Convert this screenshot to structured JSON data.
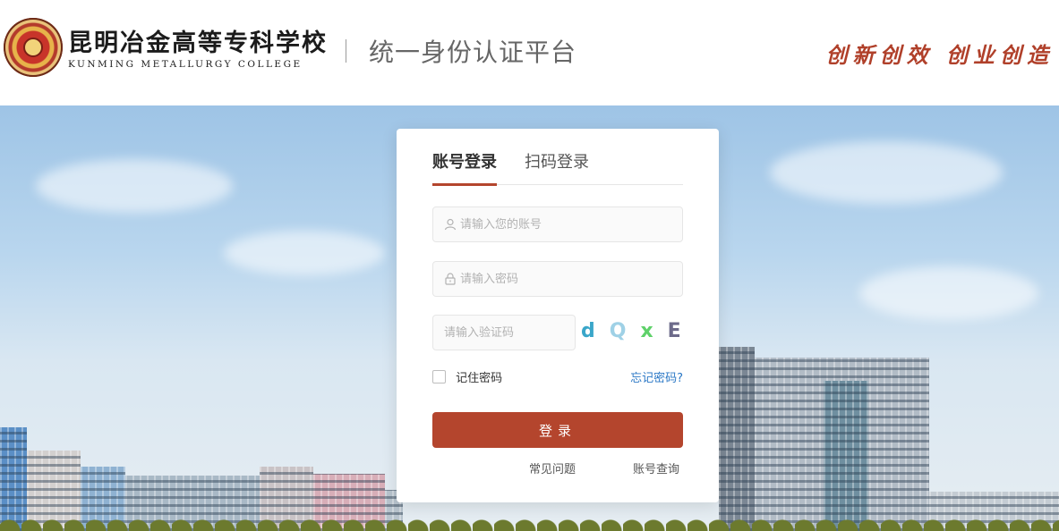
{
  "header": {
    "school_name_cn": "昆明冶金高等专科学校",
    "school_name_en": "KUNMING METALLURGY COLLEGE",
    "platform_title": "统一身份认证平台",
    "slogan": "创新创效 创业创造"
  },
  "login": {
    "tabs": [
      {
        "label": "账号登录",
        "active": true
      },
      {
        "label": "扫码登录",
        "active": false
      }
    ],
    "username_placeholder": "请输入您的账号",
    "password_placeholder": "请输入密码",
    "captcha_placeholder": "请输入验证码",
    "captcha_chars": [
      "d",
      "Q",
      "x",
      "E"
    ],
    "remember_label": "记住密码",
    "forgot_label": "忘记密码?",
    "submit_label": "登录",
    "links": {
      "faq": "常见问题",
      "account_lookup": "账号查询"
    }
  },
  "colors": {
    "accent": "#b4452d",
    "link": "#2b78c6",
    "slogan": "#b0402a"
  },
  "icons": {
    "username": "user-icon",
    "password": "lock-icon"
  }
}
